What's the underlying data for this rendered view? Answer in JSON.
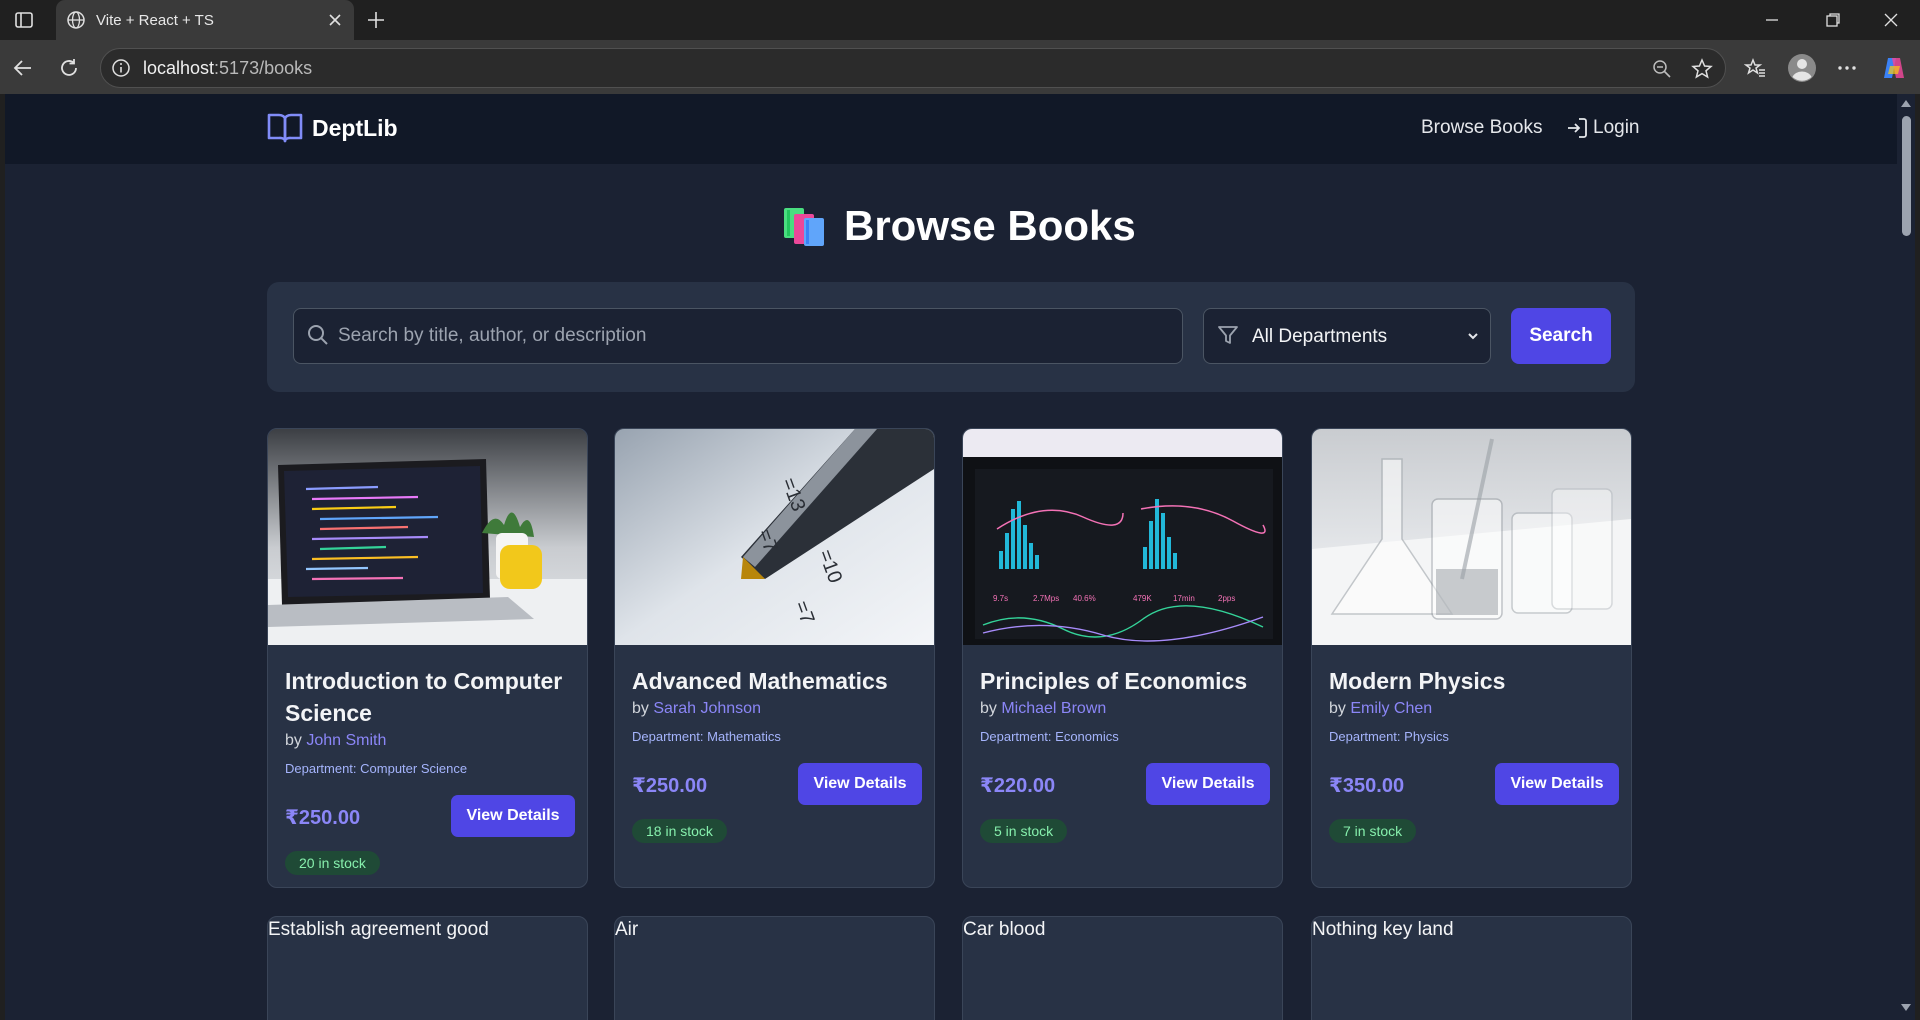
{
  "browser": {
    "tab_title": "Vite + React + TS",
    "url_host": "localhost",
    "url_path": ":5173/books"
  },
  "header": {
    "logo_text": "DeptLib",
    "nav_browse": "Browse Books",
    "nav_login": "Login"
  },
  "page": {
    "title": "Browse Books"
  },
  "search": {
    "placeholder": "Search by title, author, or description",
    "department_selected": "All Departments",
    "button_label": "Search"
  },
  "books": [
    {
      "title": "Introduction to Computer Science",
      "by": "by ",
      "author": "John Smith",
      "department": "Department: Computer Science",
      "price": "₹250.00",
      "button": "View Details",
      "stock": "20 in stock",
      "image": "laptop-with-code-photo"
    },
    {
      "title": "Advanced Mathematics",
      "by": "by ",
      "author": "Sarah Johnson",
      "department": "Department: Mathematics",
      "price": "₹250.00",
      "button": "View Details",
      "stock": "18 in stock",
      "image": "pen-on-equations-photo"
    },
    {
      "title": "Principles of Economics",
      "by": "by ",
      "author": "Michael Brown",
      "department": "Department: Economics",
      "price": "₹220.00",
      "button": "View Details",
      "stock": "5 in stock",
      "image": "analytics-dashboard-photo"
    },
    {
      "title": "Modern Physics",
      "by": "by ",
      "author": "Emily Chen",
      "department": "Department: Physics",
      "price": "₹350.00",
      "button": "View Details",
      "stock": "7 in stock",
      "image": "lab-glassware-photo"
    }
  ],
  "broken_cards": [
    {
      "alt": "Establish agreement good"
    },
    {
      "alt": "Air"
    },
    {
      "alt": "Car blood"
    },
    {
      "alt": "Nothing key land"
    }
  ],
  "colors": {
    "accent": "#4f46e5",
    "page_bg": "#1b2233",
    "card_bg": "#283245",
    "header_bg": "#111827",
    "stock_badge_bg": "#1f4a36",
    "stock_badge_text": "#86efac"
  }
}
